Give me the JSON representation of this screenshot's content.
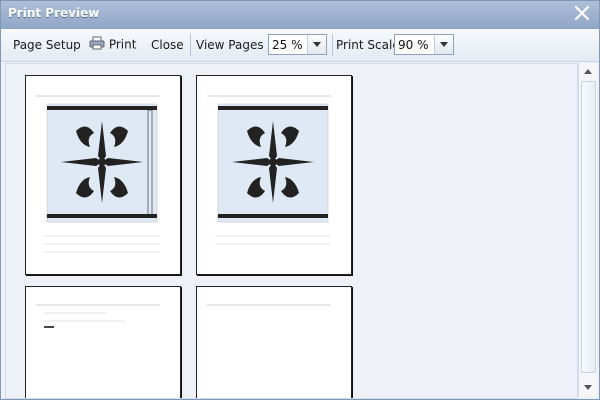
{
  "window": {
    "title": "Print Preview"
  },
  "toolbar": {
    "page_setup": "Page Setup",
    "print": "Print",
    "close": "Close",
    "view_pages_label": "View Pages at",
    "view_pages_value": "25 %",
    "print_scale_label": "Print Scale:",
    "print_scale_value": "90 %"
  },
  "colors": {
    "title_gradient_top": "#aebfd9",
    "title_gradient_bottom": "#8fa6c6",
    "content_bg": "#eef2f8"
  },
  "icons": {
    "close": "close-icon",
    "print": "printer-icon",
    "dropdown": "chevron-down-icon"
  }
}
